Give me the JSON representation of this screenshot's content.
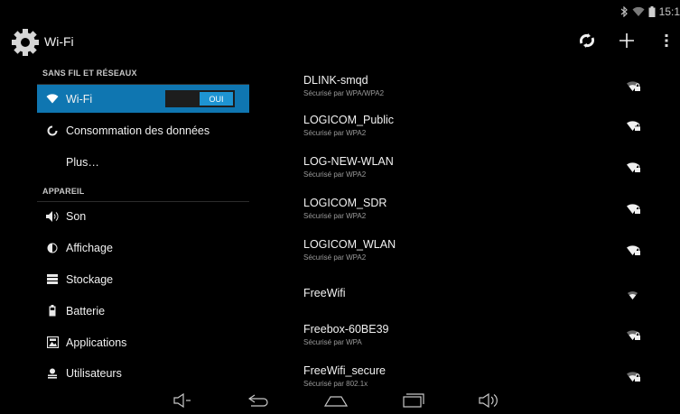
{
  "status_bar": {
    "time": "15:1",
    "icons": [
      "bluetooth-icon",
      "wifi-status-icon",
      "battery-icon"
    ]
  },
  "action_bar": {
    "app_icon": "settings-gear-icon",
    "title": "Wi-Fi",
    "actions": [
      "wps-icon",
      "add-network-icon",
      "overflow-menu-icon"
    ]
  },
  "sidebar": {
    "section_wireless": "SANS FIL ET RÉSEAUX",
    "section_device": "APPAREIL",
    "wireless_items": [
      {
        "label": "Wi-Fi",
        "icon": "wifi-icon",
        "selected": true,
        "toggle_label": "OUI"
      },
      {
        "label": "Consommation des données",
        "icon": "data-usage-icon"
      },
      {
        "label": "Plus…",
        "icon": ""
      }
    ],
    "device_items": [
      {
        "label": "Son",
        "icon": "speaker-icon"
      },
      {
        "label": "Affichage",
        "icon": "display-icon"
      },
      {
        "label": "Stockage",
        "icon": "storage-icon"
      },
      {
        "label": "Batterie",
        "icon": "battery-icon"
      },
      {
        "label": "Applications",
        "icon": "applications-icon"
      },
      {
        "label": "Utilisateurs",
        "icon": "users-icon"
      }
    ]
  },
  "networks": [
    {
      "ssid": "DLINK-smqd",
      "security": "Sécurisé par WPA/WPA2",
      "secured": true
    },
    {
      "ssid": "LOGICOM_Public",
      "security": "Sécurisé par WPA2",
      "secured": true
    },
    {
      "ssid": "LOG-NEW-WLAN",
      "security": "Sécurisé par WPA2",
      "secured": true
    },
    {
      "ssid": "LOGICOM_SDR",
      "security": "Sécurisé par WPA2",
      "secured": true
    },
    {
      "ssid": "LOGICOM_WLAN",
      "security": "Sécurisé par WPA2",
      "secured": true
    },
    {
      "ssid": "FreeWifi",
      "security": "",
      "secured": false
    },
    {
      "ssid": "Freebox-60BE39",
      "security": "Sécurisé par WPA",
      "secured": true
    },
    {
      "ssid": "FreeWifi_secure",
      "security": "Sécurisé par 802.1x",
      "secured": true
    }
  ],
  "nav_bar": [
    "volume-down-icon",
    "back-icon",
    "home-icon",
    "recent-apps-icon",
    "volume-up-icon"
  ],
  "colors": {
    "accent": "#0f76b1",
    "toggle_on": "#1e94d2",
    "background": "#000000"
  }
}
